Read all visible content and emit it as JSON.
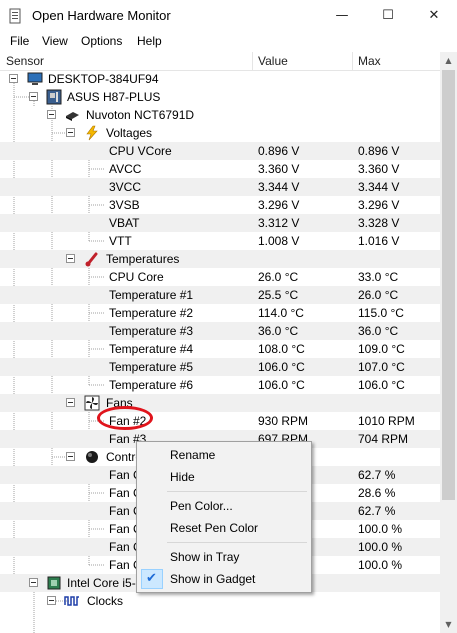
{
  "window": {
    "title": "Open Hardware Monitor",
    "controls": {
      "minimize": "—",
      "maximize": "☐",
      "close": "✕"
    }
  },
  "menu": [
    "File",
    "View",
    "Options",
    "Help"
  ],
  "columns": {
    "sensor": "Sensor",
    "value": "Value",
    "max": "Max"
  },
  "tree": [
    {
      "label": "DESKTOP-384UF94",
      "icon": "computer-icon",
      "value": "",
      "max": ""
    },
    {
      "label": "ASUS H87-PLUS",
      "icon": "motherboard-icon",
      "value": "",
      "max": ""
    },
    {
      "label": "Nuvoton NCT6791D",
      "icon": "chip-icon",
      "value": "",
      "max": ""
    },
    {
      "label": "Voltages",
      "icon": "lightning-icon",
      "value": "",
      "max": ""
    },
    {
      "label": "CPU VCore",
      "value": "0.896 V",
      "max": "0.896 V"
    },
    {
      "label": "AVCC",
      "value": "3.360 V",
      "max": "3.360 V"
    },
    {
      "label": "3VCC",
      "value": "3.344 V",
      "max": "3.344 V"
    },
    {
      "label": "3VSB",
      "value": "3.296 V",
      "max": "3.296 V"
    },
    {
      "label": "VBAT",
      "value": "3.312 V",
      "max": "3.328 V"
    },
    {
      "label": "VTT",
      "value": "1.008 V",
      "max": "1.016 V"
    },
    {
      "label": "Temperatures",
      "icon": "thermometer-icon",
      "value": "",
      "max": ""
    },
    {
      "label": "CPU Core",
      "value": "26.0 °C",
      "max": "33.0 °C"
    },
    {
      "label": "Temperature #1",
      "value": "25.5 °C",
      "max": "26.0 °C"
    },
    {
      "label": "Temperature #2",
      "value": "114.0 °C",
      "max": "115.0 °C"
    },
    {
      "label": "Temperature #3",
      "value": "36.0 °C",
      "max": "36.0 °C"
    },
    {
      "label": "Temperature #4",
      "value": "108.0 °C",
      "max": "109.0 °C"
    },
    {
      "label": "Temperature #5",
      "value": "106.0 °C",
      "max": "107.0 °C"
    },
    {
      "label": "Temperature #6",
      "value": "106.0 °C",
      "max": "106.0 °C"
    },
    {
      "label": "Fans",
      "icon": "fan-icon",
      "value": "",
      "max": ""
    },
    {
      "label": "Fan #2",
      "value": "930 RPM",
      "max": "1010 RPM"
    },
    {
      "label": "Fan #3",
      "value": "697 RPM",
      "max": "704 RPM"
    },
    {
      "label": "Controls",
      "icon": "controls-icon",
      "value": "",
      "max": ""
    },
    {
      "label": "Fan Control #1",
      "value": "",
      "max": "62.7 %"
    },
    {
      "label": "Fan Control #2",
      "value": "",
      "max": "28.6 %"
    },
    {
      "label": "Fan Control #3",
      "value": "",
      "max": "62.7 %"
    },
    {
      "label": "Fan Control #4",
      "value": "",
      "max": "100.0 %"
    },
    {
      "label": "Fan Control #5",
      "value": "",
      "max": "100.0 %"
    },
    {
      "label": "Fan Control #6",
      "value": "",
      "max": "100.0 %"
    },
    {
      "label": "Intel Core i5-4670",
      "icon": "cpu-icon",
      "value": "",
      "max": ""
    },
    {
      "label": "Clocks",
      "icon": "clock-wave-icon",
      "value": "",
      "max": ""
    }
  ],
  "context_menu": {
    "rename": "Rename",
    "hide": "Hide",
    "pen_color": "Pen Color...",
    "reset_pen_color": "Reset Pen Color",
    "show_in_tray": "Show in Tray",
    "show_in_gadget": "Show in Gadget",
    "show_in_gadget_checked": true
  },
  "colors": {
    "highlight_oval": "#e0141c",
    "check": "#1e6bd6"
  }
}
